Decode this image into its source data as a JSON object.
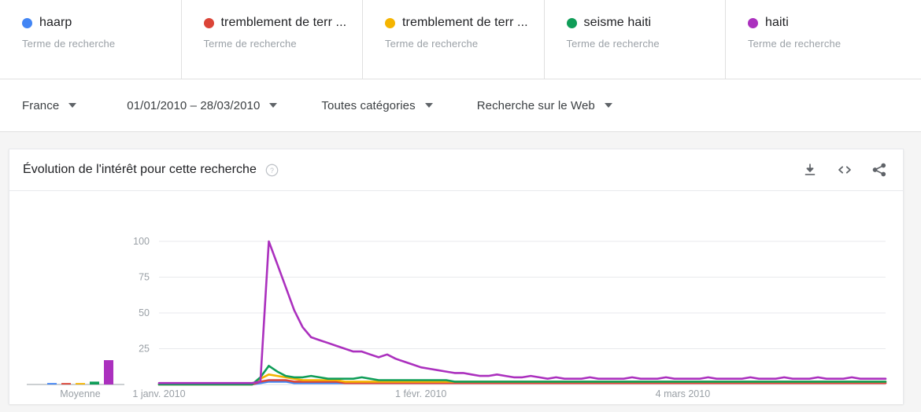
{
  "terms": [
    {
      "label": "haarp",
      "sub": "Terme de recherche",
      "color": "#4285F4"
    },
    {
      "label": "tremblement de terr ...",
      "sub": "Terme de recherche",
      "color": "#DB4437"
    },
    {
      "label": "tremblement de terr ...",
      "sub": "Terme de recherche",
      "color": "#F5B400"
    },
    {
      "label": "seisme haiti",
      "sub": "Terme de recherche",
      "color": "#0F9D58"
    },
    {
      "label": "haiti",
      "sub": "Terme de recherche",
      "color": "#AB30BE"
    }
  ],
  "filters": [
    {
      "name": "region",
      "label": "France"
    },
    {
      "name": "date-range",
      "label": "01/01/2010 – 28/03/2010"
    },
    {
      "name": "category",
      "label": "Toutes catégories"
    },
    {
      "name": "search-type",
      "label": "Recherche sur le Web"
    }
  ],
  "chart_card": {
    "title": "Évolution de l'intérêt pour cette recherche",
    "help_icon": "help-circle-icon",
    "actions": [
      {
        "name": "download-icon",
        "tooltip": "Télécharger"
      },
      {
        "name": "embed-code-icon",
        "tooltip": "Code d'intégration"
      },
      {
        "name": "share-icon",
        "tooltip": "Partager"
      }
    ],
    "average_label": "Moyenne"
  },
  "chart_data": {
    "type": "line",
    "title": "Évolution de l'intérêt pour cette recherche",
    "xlabel": "",
    "ylabel": "",
    "ylim": [
      0,
      100
    ],
    "yticks": [
      25,
      50,
      75,
      100
    ],
    "xtick_labels": [
      "1 janv. 2010",
      "1 févr. 2010",
      "4 mars 2010"
    ],
    "xtick_positions": [
      0,
      31,
      62
    ],
    "grid": true,
    "legend_position": "top-cards",
    "n_points": 87,
    "averages": [
      {
        "name": "haarp",
        "value": 1
      },
      {
        "name": "tremblement de terr ...",
        "value": 1
      },
      {
        "name": "tremblement de terr ...",
        "value": 1
      },
      {
        "name": "seisme haiti",
        "value": 2
      },
      {
        "name": "haiti",
        "value": 17
      }
    ],
    "series": [
      {
        "name": "haarp",
        "color": "#4285F4",
        "values": [
          0,
          0,
          0,
          0,
          0,
          0,
          0,
          0,
          0,
          0,
          0,
          0,
          1,
          2,
          2,
          2,
          1,
          1,
          1,
          1,
          1,
          1,
          1,
          1,
          1,
          1,
          1,
          1,
          1,
          1,
          1,
          1,
          1,
          1,
          1,
          1,
          1,
          1,
          1,
          1,
          1,
          1,
          1,
          1,
          1,
          1,
          1,
          1,
          1,
          1,
          1,
          1,
          1,
          1,
          1,
          1,
          1,
          1,
          1,
          1,
          1,
          1,
          1,
          1,
          1,
          1,
          1,
          1,
          1,
          1,
          1,
          1,
          1,
          1,
          1,
          1,
          1,
          1,
          1,
          1,
          1,
          1,
          1,
          1,
          1,
          1,
          1
        ]
      },
      {
        "name": "tremblement de terr ...",
        "color": "#DB4437",
        "values": [
          0,
          0,
          0,
          0,
          0,
          0,
          0,
          0,
          0,
          0,
          0,
          0,
          2,
          3,
          3,
          3,
          2,
          2,
          2,
          2,
          2,
          2,
          1,
          1,
          1,
          1,
          1,
          1,
          1,
          1,
          1,
          1,
          1,
          1,
          1,
          1,
          1,
          1,
          1,
          1,
          1,
          1,
          1,
          1,
          1,
          1,
          1,
          1,
          1,
          1,
          1,
          1,
          1,
          1,
          1,
          1,
          1,
          1,
          1,
          1,
          1,
          1,
          1,
          1,
          1,
          1,
          1,
          1,
          1,
          1,
          1,
          1,
          1,
          1,
          1,
          1,
          1,
          1,
          1,
          1,
          1,
          1,
          1,
          1,
          1,
          1,
          1
        ]
      },
      {
        "name": "tremblement de terr ...",
        "color": "#F5B400",
        "values": [
          0,
          0,
          0,
          0,
          0,
          0,
          0,
          0,
          0,
          0,
          0,
          0,
          4,
          7,
          6,
          5,
          4,
          3,
          3,
          3,
          3,
          3,
          2,
          2,
          2,
          2,
          2,
          2,
          2,
          2,
          2,
          2,
          2,
          2,
          2,
          2,
          2,
          2,
          2,
          2,
          2,
          2,
          2,
          2,
          2,
          2,
          2,
          2,
          2,
          2,
          2,
          2,
          2,
          2,
          2,
          2,
          2,
          2,
          2,
          2,
          2,
          2,
          2,
          2,
          2,
          2,
          2,
          2,
          2,
          2,
          2,
          2,
          2,
          2,
          2,
          2,
          2,
          2,
          2,
          2,
          2,
          2,
          2,
          2,
          2,
          2,
          2
        ]
      },
      {
        "name": "seisme haiti",
        "color": "#0F9D58",
        "values": [
          0,
          0,
          0,
          0,
          0,
          0,
          0,
          0,
          0,
          0,
          0,
          0,
          5,
          13,
          9,
          6,
          5,
          5,
          6,
          5,
          4,
          4,
          4,
          4,
          5,
          4,
          3,
          3,
          3,
          3,
          3,
          3,
          3,
          3,
          3,
          2,
          2,
          2,
          2,
          2,
          2,
          2,
          2,
          2,
          2,
          2,
          2,
          2,
          2,
          2,
          2,
          2,
          2,
          2,
          2,
          2,
          2,
          2,
          2,
          2,
          2,
          2,
          2,
          2,
          2,
          2,
          2,
          2,
          2,
          2,
          2,
          2,
          2,
          2,
          2,
          2,
          2,
          2,
          2,
          2,
          2,
          2,
          2,
          2,
          2,
          2,
          2
        ]
      },
      {
        "name": "haiti",
        "color": "#AB30BE",
        "values": [
          1,
          1,
          1,
          1,
          1,
          1,
          1,
          1,
          1,
          1,
          1,
          1,
          2,
          100,
          84,
          68,
          52,
          40,
          33,
          31,
          29,
          27,
          25,
          23,
          23,
          21,
          19,
          21,
          18,
          16,
          14,
          12,
          11,
          10,
          9,
          8,
          8,
          7,
          6,
          6,
          7,
          6,
          5,
          5,
          6,
          5,
          4,
          5,
          4,
          4,
          4,
          5,
          4,
          4,
          4,
          4,
          5,
          4,
          4,
          4,
          5,
          4,
          4,
          4,
          4,
          5,
          4,
          4,
          4,
          4,
          5,
          4,
          4,
          4,
          5,
          4,
          4,
          4,
          5,
          4,
          4,
          4,
          5,
          4,
          4,
          4,
          4
        ]
      }
    ]
  }
}
